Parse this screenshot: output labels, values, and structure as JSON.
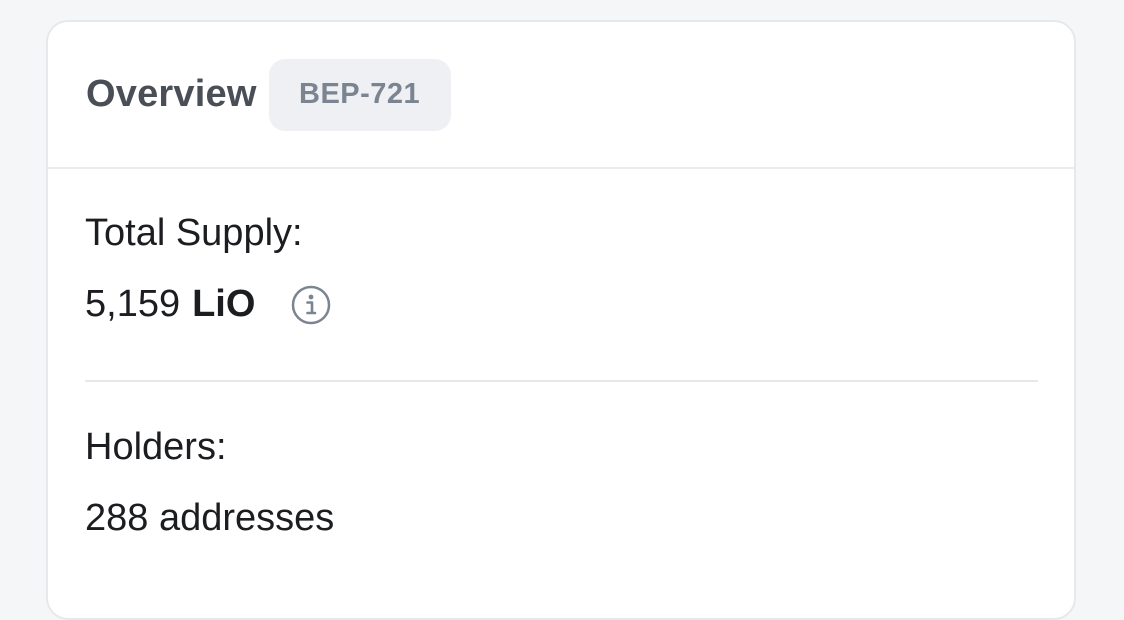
{
  "header": {
    "title": "Overview",
    "badge": "BEP-721"
  },
  "total_supply": {
    "label": "Total Supply:",
    "amount": "5,159",
    "symbol": "LiO",
    "icon": "info-icon"
  },
  "holders": {
    "label": "Holders:",
    "value": "288 addresses"
  },
  "colors": {
    "card_bg": "#ffffff",
    "page_bg": "#f5f6f8",
    "badge_bg": "#eef0f3",
    "badge_text": "#7b8491",
    "title_text": "#4a4f57",
    "icon_color": "#7b8491"
  }
}
